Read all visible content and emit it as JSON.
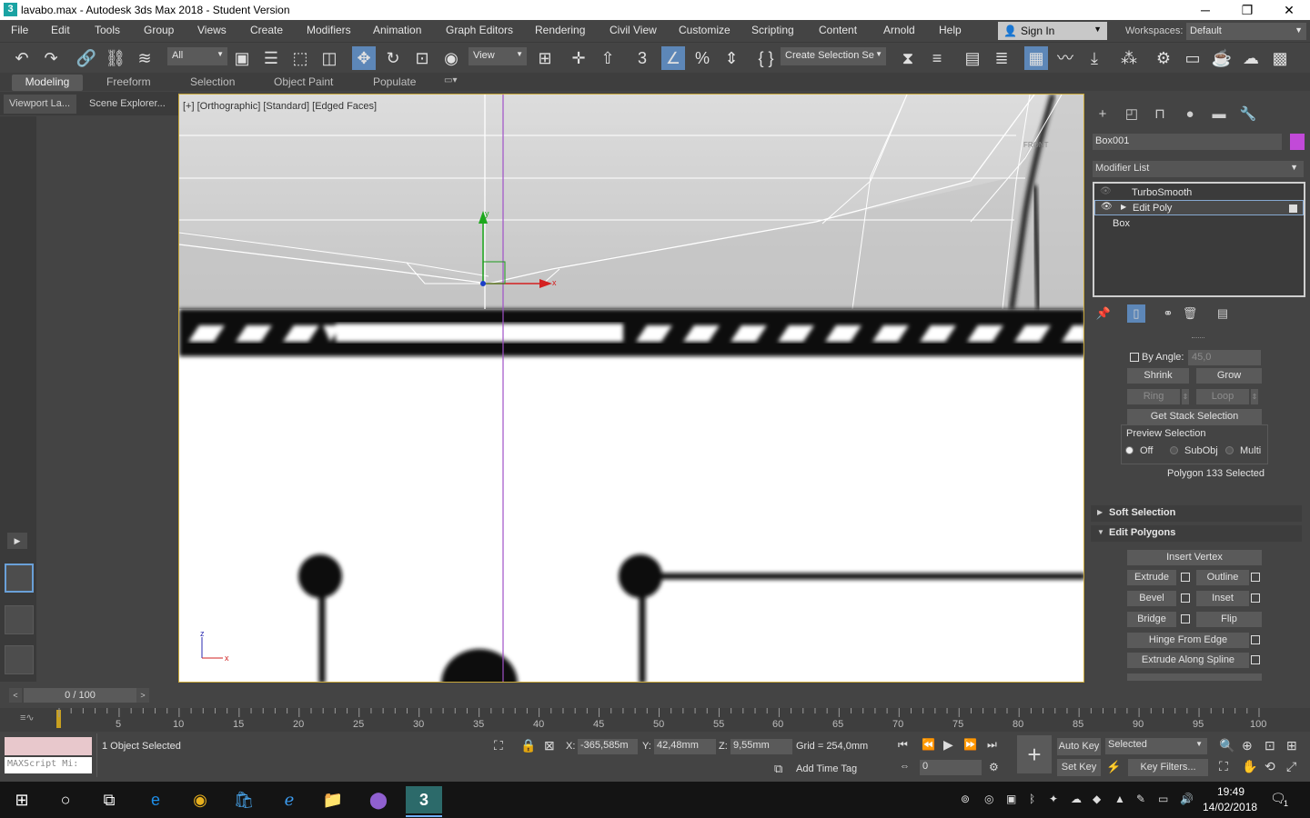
{
  "window": {
    "title": "lavabo.max - Autodesk 3ds Max 2018 - Student Version",
    "icon": "3",
    "minimize": "─",
    "maximize": "❐",
    "close": "✕"
  },
  "menu": [
    "File",
    "Edit",
    "Tools",
    "Group",
    "Views",
    "Create",
    "Modifiers",
    "Animation",
    "Graph Editors",
    "Rendering",
    "Civil View",
    "Customize",
    "Scripting",
    "Content",
    "Arnold",
    "Help"
  ],
  "signin": {
    "label": "Sign In"
  },
  "workspaces": {
    "label": "Workspaces:",
    "value": "Default"
  },
  "toolbar": {
    "filter_value": "All",
    "refcoord_value": "View",
    "named_selection": "Create Selection Se"
  },
  "ribbon_tabs": [
    "Modeling",
    "Freeform",
    "Selection",
    "Object Paint",
    "Populate"
  ],
  "scene_tabs": [
    "Viewport La...",
    "Scene Explorer..."
  ],
  "viewport": {
    "label": "[+] [Orthographic] [Standard] [Edged Faces]",
    "gizmo_y": "y",
    "gizmo_x": "x",
    "axis_z": "z",
    "axis_x": "x",
    "front_label": "FRONT"
  },
  "command_panel": {
    "object_name": "Box001",
    "object_color": "#c24ad8",
    "modifier_list": "Modifier List",
    "stack": [
      "TurboSmooth",
      "Edit Poly",
      "Box"
    ],
    "by_angle_label": "By Angle:",
    "by_angle_value": "45,0",
    "shrink": "Shrink",
    "grow": "Grow",
    "ring": "Ring",
    "loop": "Loop",
    "get_stack_selection": "Get Stack Selection",
    "preview_selection": "Preview Selection",
    "preview_off": "Off",
    "preview_subobj": "SubObj",
    "preview_multi": "Multi",
    "selection_status": "Polygon 133 Selected",
    "soft_selection": "Soft Selection",
    "edit_polygons": "Edit Polygons",
    "insert_vertex": "Insert Vertex",
    "extrude": "Extrude",
    "outline": "Outline",
    "bevel": "Bevel",
    "inset": "Inset",
    "bridge": "Bridge",
    "flip": "Flip",
    "hinge_from_edge": "Hinge From Edge",
    "extrude_along_spline": "Extrude Along Spline"
  },
  "timeline": {
    "frame": "0 / 100",
    "ticks": [
      "5",
      "10",
      "15",
      "20",
      "25",
      "30",
      "35",
      "40",
      "45",
      "50",
      "55",
      "60",
      "65",
      "70",
      "75",
      "80",
      "85",
      "90",
      "95",
      "100"
    ]
  },
  "status": {
    "script_placeholder": "MAXScript Mi:",
    "selected": "1 Object Selected",
    "x_label": "X:",
    "x_value": "-365,585m",
    "y_label": "Y:",
    "y_value": "42,48mm",
    "z_label": "Z:",
    "z_value": "9,55mm",
    "grid": "Grid = 254,0mm",
    "add_time_tag": "Add Time Tag",
    "auto_key": "Auto Key",
    "set_key": "Set Key",
    "key_mode": "Selected",
    "key_filters": "Key Filters...",
    "frame_value": "0"
  },
  "taskbar": {
    "time": "19:49",
    "date": "14/02/2018",
    "notification_count": "1"
  }
}
